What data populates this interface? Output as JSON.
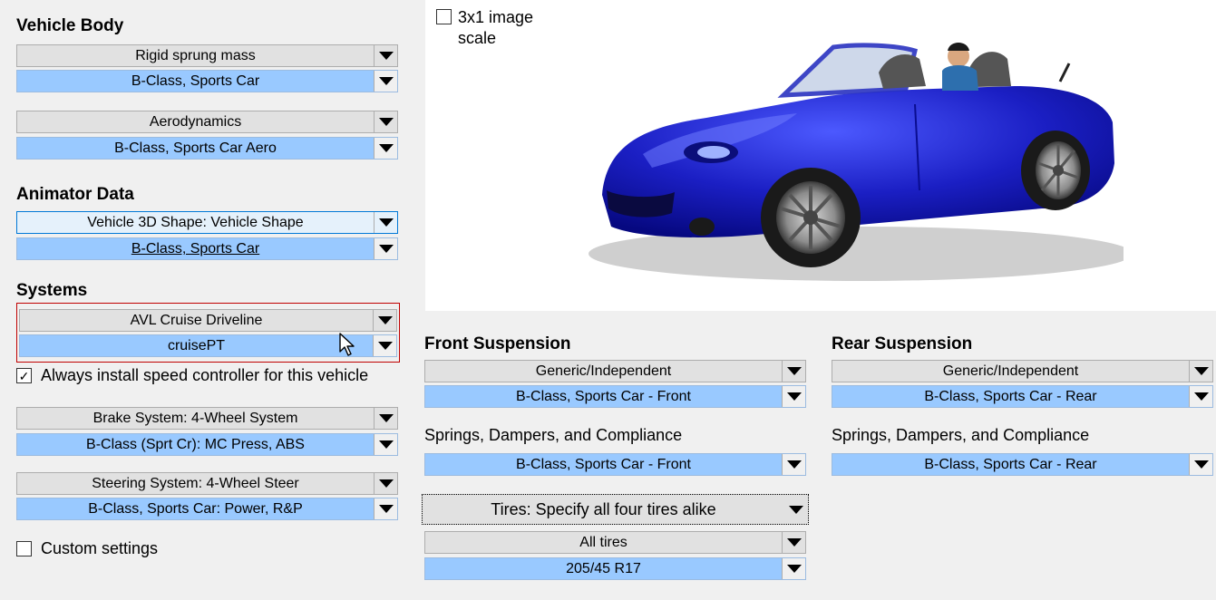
{
  "vehicle_body": {
    "title": "Vehicle Body",
    "sprung_mass": {
      "type": "Rigid sprung mass",
      "dataset": "B-Class, Sports Car"
    },
    "aero": {
      "type": "Aerodynamics",
      "dataset": "B-Class, Sports Car Aero"
    }
  },
  "animator": {
    "title": "Animator Data",
    "shape": {
      "type": "Vehicle 3D Shape: Vehicle Shape",
      "dataset": "B-Class, Sports Car"
    }
  },
  "systems": {
    "title": "Systems",
    "driveline": {
      "type": "AVL Cruise Driveline",
      "dataset": "cruisePT"
    },
    "speed_controller_label": "Always install speed controller for this vehicle",
    "speed_controller_checked": true,
    "brake": {
      "type": "Brake System: 4-Wheel System",
      "dataset": "B-Class (Sprt Cr): MC Press, ABS"
    },
    "steering": {
      "type": "Steering System: 4-Wheel Steer",
      "dataset": "B-Class, Sports Car: Power, R&P"
    },
    "custom_settings_label": "Custom settings",
    "custom_settings_checked": false
  },
  "image": {
    "scale_label": "3x1 image scale",
    "scale_checked": false,
    "subject": "blue convertible sports car with driver"
  },
  "front_suspension": {
    "title": "Front Suspension",
    "type": "Generic/Independent",
    "dataset": "B-Class, Sports Car - Front",
    "springs_label": "Springs, Dampers, and Compliance",
    "springs_dataset": "B-Class, Sports Car - Front"
  },
  "rear_suspension": {
    "title": "Rear Suspension",
    "type": "Generic/Independent",
    "dataset": "B-Class, Sports Car - Rear",
    "springs_label": "Springs, Dampers, and Compliance",
    "springs_dataset": "B-Class, Sports Car - Rear"
  },
  "tires": {
    "mode": "Tires: Specify all four tires alike",
    "type": "All tires",
    "dataset": "205/45 R17"
  },
  "colors": {
    "selected_blue": "#99c9ff",
    "car_body": "#1b1fc4",
    "highlight_border": "#c00000"
  }
}
